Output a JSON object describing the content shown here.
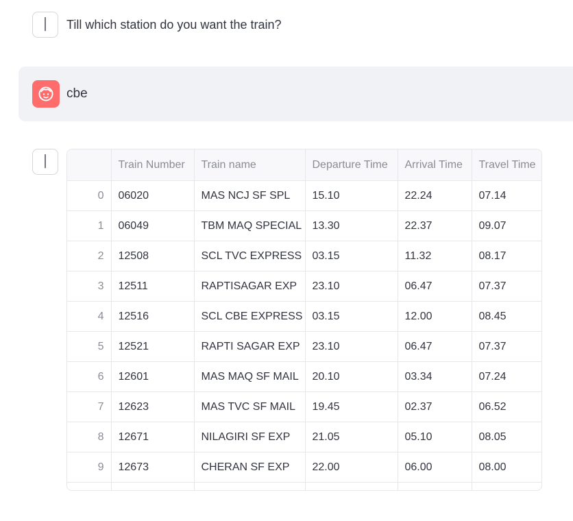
{
  "messages": {
    "assistant_prompt": "Till which station do you want the train?",
    "user_reply": "cbe"
  },
  "icons": {
    "assistant_avatar": "robot-icon",
    "user_avatar": "smiley-face-icon",
    "user_avatar_color": "#ff6c6c"
  },
  "table": {
    "columns": [
      "",
      "Train Number",
      "Train name",
      "Departure Time",
      "Arrival Time",
      "Travel Time"
    ],
    "rows": [
      {
        "index": "0",
        "number": "06020",
        "name": "MAS NCJ SF SPL",
        "departure": "15.10",
        "arrival": "22.24",
        "travel": "07.14"
      },
      {
        "index": "1",
        "number": "06049",
        "name": "TBM MAQ SPECIAL",
        "departure": "13.30",
        "arrival": "22.37",
        "travel": "09.07"
      },
      {
        "index": "2",
        "number": "12508",
        "name": "SCL TVC EXPRESS",
        "departure": "03.15",
        "arrival": "11.32",
        "travel": "08.17"
      },
      {
        "index": "3",
        "number": "12511",
        "name": "RAPTISAGAR EXP",
        "departure": "23.10",
        "arrival": "06.47",
        "travel": "07.37"
      },
      {
        "index": "4",
        "number": "12516",
        "name": "SCL CBE EXPRESS",
        "departure": "03.15",
        "arrival": "12.00",
        "travel": "08.45"
      },
      {
        "index": "5",
        "number": "12521",
        "name": "RAPTI SAGAR EXP",
        "departure": "23.10",
        "arrival": "06.47",
        "travel": "07.37"
      },
      {
        "index": "6",
        "number": "12601",
        "name": "MAS MAQ SF MAIL",
        "departure": "20.10",
        "arrival": "03.34",
        "travel": "07.24"
      },
      {
        "index": "7",
        "number": "12623",
        "name": "MAS TVC SF MAIL",
        "departure": "19.45",
        "arrival": "02.37",
        "travel": "06.52"
      },
      {
        "index": "8",
        "number": "12671",
        "name": "NILAGIRI SF EXP",
        "departure": "21.05",
        "arrival": "05.10",
        "travel": "08.05"
      },
      {
        "index": "9",
        "number": "12673",
        "name": "CHERAN SF EXP",
        "departure": "22.00",
        "arrival": "06.00",
        "travel": "08.00"
      }
    ]
  }
}
